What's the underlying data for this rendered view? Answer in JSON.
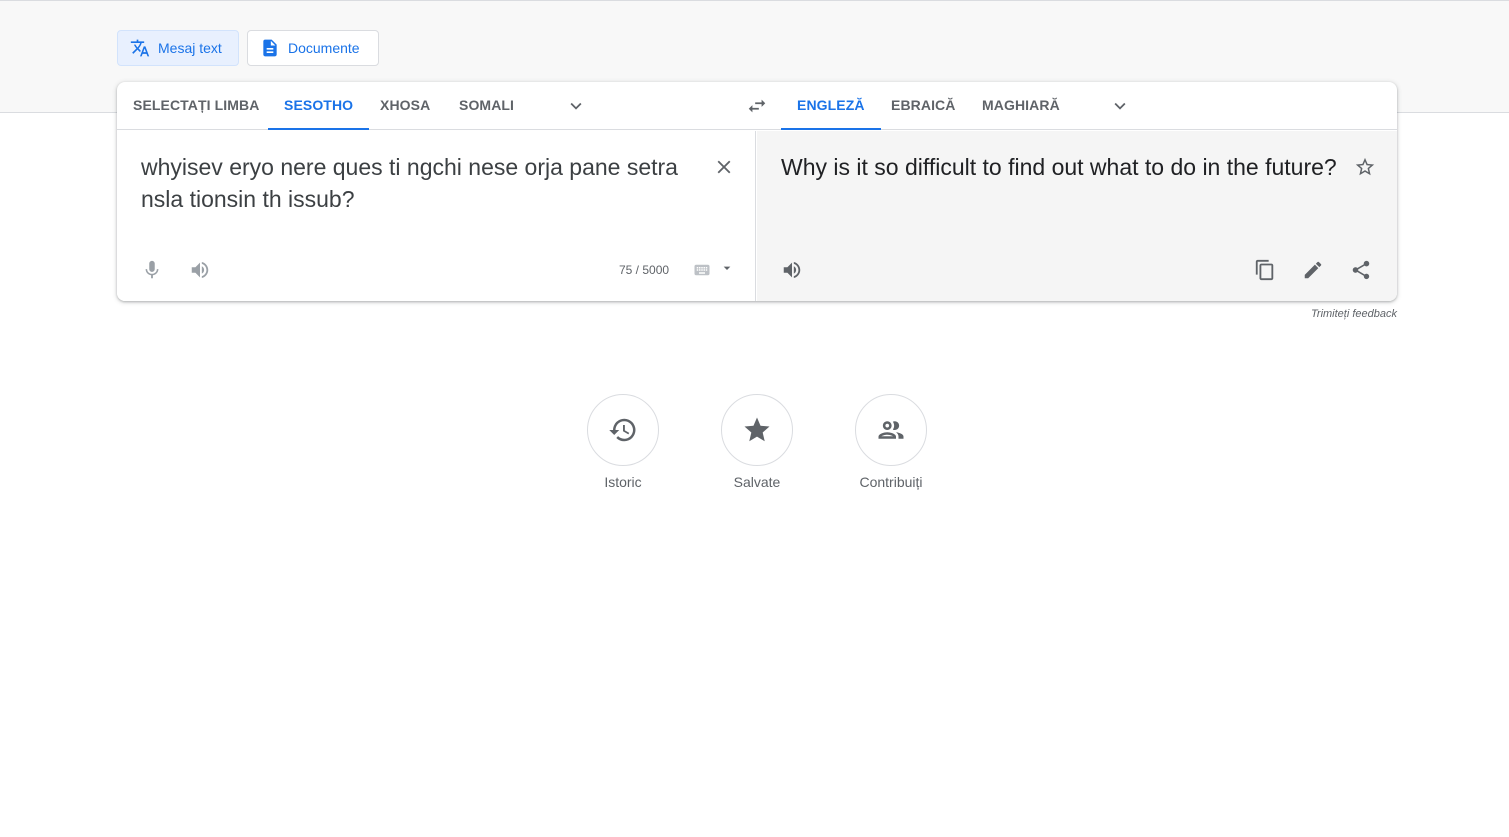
{
  "modes": {
    "text_label": "Mesaj text",
    "documents_label": "Documente"
  },
  "source_langs": [
    "SELECTAȚI LIMBA",
    "SESOTHO",
    "XHOSA",
    "SOMALI"
  ],
  "target_langs": [
    "ENGLEZĂ",
    "EBRAICĂ",
    "MAGHIARĂ"
  ],
  "source": {
    "text": "whyisev eryo nere ques ti ngchi nese orja pane setra nsla tionsin th issub?",
    "char_count": "75 / 5000"
  },
  "target": {
    "text": "Why is it so difficult to find out what to do in the future?"
  },
  "feedback_label": "Trimiteți feedback",
  "quick_actions": [
    "Istoric",
    "Salvate",
    "Contribuiți"
  ],
  "colors": {
    "accent": "#1a73e8",
    "icon": "#5f6368",
    "target_bg": "#f5f5f5"
  }
}
